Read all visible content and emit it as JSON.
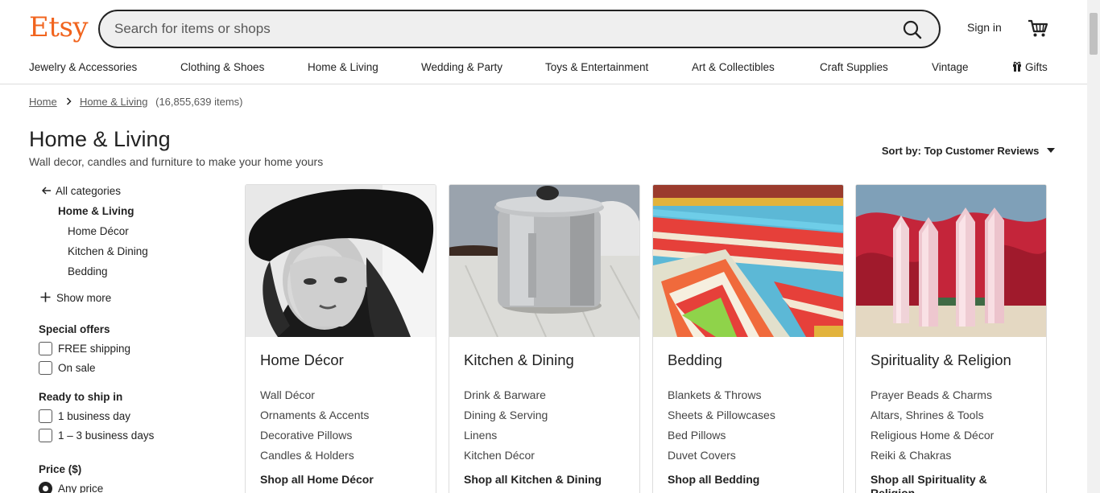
{
  "header": {
    "logo": "Etsy",
    "search_placeholder": "Search for items or shops",
    "sign_in": "Sign in"
  },
  "nav": [
    "Jewelry & Accessories",
    "Clothing & Shoes",
    "Home & Living",
    "Wedding & Party",
    "Toys & Entertainment",
    "Art & Collectibles",
    "Craft Supplies",
    "Vintage",
    "Gifts"
  ],
  "breadcrumb": {
    "home": "Home",
    "current": "Home & Living",
    "count": "(16,855,639 items)"
  },
  "page": {
    "title": "Home & Living",
    "subtitle": "Wall decor, candles and furniture to make your home yours",
    "sort_label": "Sort by: Top Customer Reviews"
  },
  "sidebar": {
    "all_categories": "All categories",
    "current": "Home & Living",
    "subcategories": [
      "Home Décor",
      "Kitchen & Dining",
      "Bedding"
    ],
    "show_more": "Show more",
    "special_offers": {
      "heading": "Special offers",
      "options": [
        "FREE shipping",
        "On sale"
      ]
    },
    "ready_to_ship": {
      "heading": "Ready to ship in",
      "options": [
        "1 business day",
        "1 – 3 business days"
      ]
    },
    "price": {
      "heading": "Price ($)",
      "selected": "Any price"
    }
  },
  "cards": [
    {
      "title": "Home Décor",
      "links": [
        "Wall Décor",
        "Ornaments & Accents",
        "Decorative Pillows",
        "Candles & Holders"
      ],
      "shop_all": "Shop all Home Décor"
    },
    {
      "title": "Kitchen & Dining",
      "links": [
        "Drink & Barware",
        "Dining & Serving",
        "Linens",
        "Kitchen Décor"
      ],
      "shop_all": "Shop all Kitchen & Dining"
    },
    {
      "title": "Bedding",
      "links": [
        "Blankets & Throws",
        "Sheets & Pillowcases",
        "Bed Pillows",
        "Duvet Covers"
      ],
      "shop_all": "Shop all Bedding"
    },
    {
      "title": "Spirituality & Religion",
      "links": [
        "Prayer Beads & Charms",
        "Altars, Shrines & Tools",
        "Religious Home & Décor",
        "Reiki & Chakras"
      ],
      "shop_all": "Shop all Spirituality & Religion"
    }
  ],
  "colors": {
    "brand": "#F1641E",
    "text": "#222222",
    "border": "#DDDDDD"
  }
}
